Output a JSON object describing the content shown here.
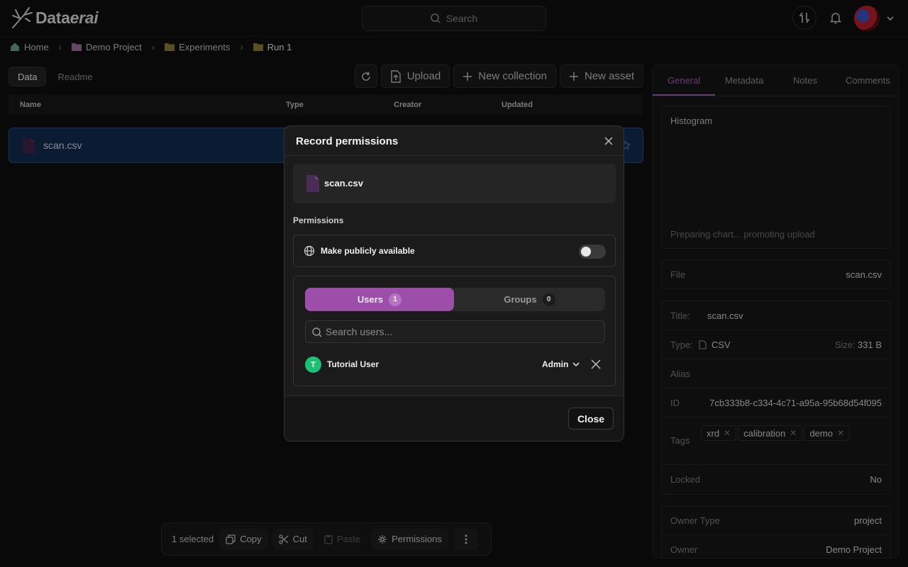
{
  "app": {
    "logo_prefix": "Data",
    "logo_suffix": "erai"
  },
  "search": {
    "label": "Search"
  },
  "breadcrumb": {
    "items": [
      "Home",
      "Demo Project",
      "Experiments",
      "Run 1"
    ]
  },
  "left": {
    "tabs": [
      "Data",
      "Readme"
    ],
    "toolbar": {
      "upload": "Upload",
      "new_collection": "New collection",
      "new_asset": "New asset"
    },
    "columns": [
      "Name",
      "Type",
      "Creator",
      "Updated"
    ],
    "rows": [
      {
        "name": "scan.csv",
        "selected": true
      }
    ]
  },
  "action_bar": {
    "selected": "1 selected",
    "copy": "Copy",
    "cut": "Cut",
    "paste": "Paste",
    "permissions": "Permissions"
  },
  "right": {
    "tabs": [
      "General",
      "Metadata",
      "Notes",
      "Comments"
    ],
    "histogram": {
      "title": "Histogram",
      "status": "Preparing chart... promoting upload"
    },
    "file": {
      "key": "File",
      "value": "scan.csv"
    },
    "title": {
      "key": "Title:",
      "value": "scan.csv"
    },
    "type": {
      "key": "Type:",
      "value": "CSV",
      "size_key": "Size:",
      "size_value": "331 B"
    },
    "alias": {
      "key": "Alias"
    },
    "id": {
      "key": "ID",
      "value": "7cb333b8-c334-4c71-a95a-95b68d54f095"
    },
    "tags": {
      "key": "Tags",
      "values": [
        "xrd",
        "calibration",
        "demo"
      ]
    },
    "locked": {
      "key": "Locked",
      "value": "No"
    },
    "owner_type": {
      "key": "Owner Type",
      "value": "project"
    },
    "owner": {
      "key": "Owner",
      "value": "Demo Project"
    }
  },
  "modal": {
    "title": "Record permissions",
    "file_name": "scan.csv",
    "permissions_label": "Permissions",
    "public_label": "Make publicly available",
    "public_enabled": false,
    "segments": {
      "users": "Users",
      "users_count": "1",
      "groups": "Groups",
      "groups_count": "0"
    },
    "search_placeholder": "Search users...",
    "user": {
      "initial": "T",
      "name": "Tutorial User",
      "role": "Admin"
    },
    "close": "Close"
  },
  "colors": {
    "accent": "#9b4fa8",
    "selected_row": "#112a4c",
    "avatar_green": "#1dbf73"
  }
}
